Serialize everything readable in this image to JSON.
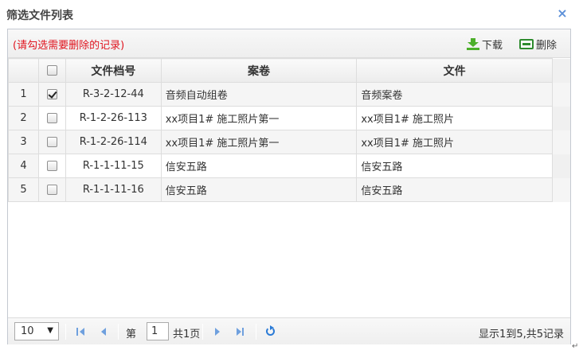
{
  "dialog": {
    "title": "筛选文件列表",
    "close_glyph": "×"
  },
  "toolbar": {
    "notice": "(请勾选需要删除的记录)",
    "download_label": "下载",
    "delete_label": "删除",
    "download_icon": "download-icon",
    "delete_icon": "delete-icon"
  },
  "table": {
    "columns": [
      "文件档号",
      "案卷",
      "文件"
    ],
    "rows": [
      {
        "num": "1",
        "checked": true,
        "code": "R-3-2-12-44",
        "volume": "音频自动组卷",
        "file": "音频案卷"
      },
      {
        "num": "2",
        "checked": false,
        "code": "R-1-2-26-113",
        "volume": "xx项目1# 施工照片第一",
        "file": "xx项目1# 施工照片"
      },
      {
        "num": "3",
        "checked": false,
        "code": "R-1-2-26-114",
        "volume": "xx项目1# 施工照片第一",
        "file": "xx项目1# 施工照片"
      },
      {
        "num": "4",
        "checked": false,
        "code": "R-1-1-11-15",
        "volume": "信安五路",
        "file": "信安五路"
      },
      {
        "num": "5",
        "checked": false,
        "code": "R-1-1-11-16",
        "volume": "信安五路",
        "file": "信安五路"
      }
    ]
  },
  "pager": {
    "page_size": "10",
    "page_prefix": "第",
    "page_value": "1",
    "page_total": "共1页",
    "info": "显示1到5,共5记录"
  },
  "colors": {
    "notice": "#e0151f",
    "accent": "#2b7bd6",
    "border": "#c4c9d1"
  }
}
